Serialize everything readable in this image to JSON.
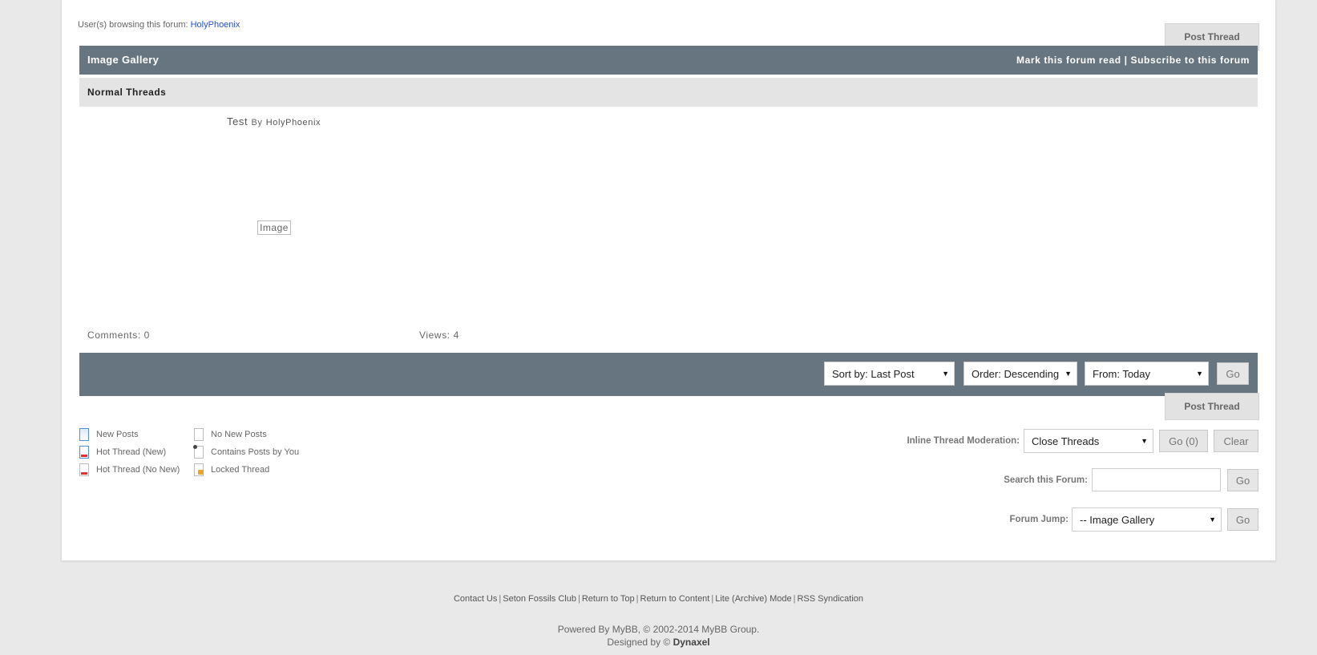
{
  "browsing": {
    "label": "User(s) browsing this forum:",
    "user": "HolyPhoenix"
  },
  "buttons": {
    "post_thread": "Post Thread",
    "go": "Go",
    "go_count": "Go (0)",
    "clear": "Clear"
  },
  "forum": {
    "title": "Image Gallery",
    "mark_read": "Mark this forum read",
    "sep": "|",
    "subscribe": "Subscribe to this forum",
    "section": "Normal Threads"
  },
  "thread": {
    "title": "Test",
    "by": "By",
    "author": "HolyPhoenix",
    "image_alt": "Image",
    "comments": "Comments: 0",
    "views": "Views: 4"
  },
  "sort": {
    "sort_by": "Sort by: Last Post",
    "order": "Order: Descending",
    "from": "From: Today"
  },
  "legend": [
    {
      "label": "New Posts",
      "icon": "new-posts-icon"
    },
    {
      "label": "Hot Thread (New)",
      "icon": "hot-thread-new-icon"
    },
    {
      "label": "Hot Thread (No New)",
      "icon": "hot-thread-no-new-icon"
    },
    {
      "label": "No New Posts",
      "icon": "no-new-posts-icon"
    },
    {
      "label": "Contains Posts by You",
      "icon": "contains-posts-icon"
    },
    {
      "label": "Locked Thread",
      "icon": "locked-thread-icon"
    }
  ],
  "moderation": {
    "label": "Inline Thread Moderation:",
    "selected": "Close Threads"
  },
  "search": {
    "label": "Search this Forum:",
    "value": ""
  },
  "jump": {
    "label": "Forum Jump:",
    "selected": "-- Image Gallery"
  },
  "footer": {
    "links": [
      "Contact Us",
      "Seton Fossils Club",
      "Return to Top",
      "Return to Content",
      "Lite (Archive) Mode",
      "RSS Syndication"
    ],
    "powered": "Powered By MyBB, © 2002-2014 MyBB Group.",
    "designed_prefix": "Designed by ©",
    "designer": "Dynaxel"
  },
  "colors": {
    "header_bg": "#66757f",
    "link": "#2a4fce",
    "category_bg": "#e4e4e4",
    "page_bg": "#e9e9e9"
  }
}
